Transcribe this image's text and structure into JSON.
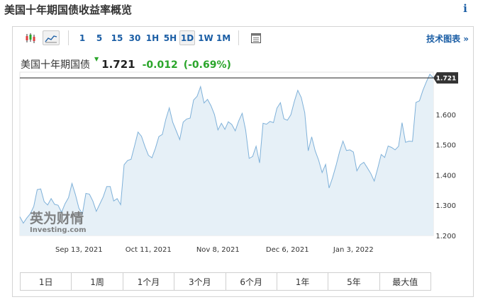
{
  "header": {
    "title": "美国十年期国债收益率概览",
    "info_icon": "i"
  },
  "toolbar": {
    "chart_type_icons": [
      "candlestick-icon",
      "area-chart-icon"
    ],
    "intervals": [
      {
        "label": "1",
        "active": false
      },
      {
        "label": "5",
        "active": false
      },
      {
        "label": "15",
        "active": false
      },
      {
        "label": "30",
        "active": false
      },
      {
        "label": "1H",
        "active": false
      },
      {
        "label": "5H",
        "active": false
      },
      {
        "label": "1D",
        "active": true
      },
      {
        "label": "1W",
        "active": false
      },
      {
        "label": "1M",
        "active": false
      }
    ],
    "table_icon": "table-icon",
    "tech_link": "技术图表 »"
  },
  "quote": {
    "name": "美国十年期国债",
    "arrow": "▼",
    "price": "1.721",
    "change": "-0.012",
    "change_pct": "(-0.69%)"
  },
  "watermark": {
    "cn": "英为财情",
    "en": "Investing.com"
  },
  "colors": {
    "accent": "#1b5ea5",
    "positive": "#2aa52a",
    "line": "#7fb1d9",
    "area": "#e6f0f7"
  },
  "chart_data": {
    "type": "area",
    "ylim": [
      1.2,
      1.74
    ],
    "y_ticks": [
      "1.200",
      "1.300",
      "1.400",
      "1.500",
      "1.600"
    ],
    "x_ticks": [
      "Sep 13, 2021",
      "Oct 11, 2021",
      "Nov 8, 2021",
      "Dec 6, 2021",
      "Jan 3, 2022"
    ],
    "x_tick_index": [
      17,
      37,
      57,
      77,
      96
    ],
    "last_value_label": "1.721",
    "last_value": 1.721,
    "values": [
      1.262,
      1.241,
      1.258,
      1.272,
      1.296,
      1.352,
      1.354,
      1.312,
      1.301,
      1.322,
      1.303,
      1.3,
      1.277,
      1.305,
      1.325,
      1.372,
      1.335,
      1.29,
      1.272,
      1.339,
      1.337,
      1.314,
      1.28,
      1.304,
      1.328,
      1.362,
      1.362,
      1.314,
      1.322,
      1.302,
      1.434,
      1.448,
      1.452,
      1.496,
      1.542,
      1.528,
      1.494,
      1.465,
      1.457,
      1.488,
      1.527,
      1.534,
      1.584,
      1.622,
      1.574,
      1.546,
      1.517,
      1.575,
      1.585,
      1.588,
      1.648,
      1.66,
      1.692,
      1.638,
      1.65,
      1.629,
      1.6,
      1.549,
      1.571,
      1.551,
      1.576,
      1.567,
      1.546,
      1.579,
      1.604,
      1.548,
      1.455,
      1.461,
      1.495,
      1.44,
      1.571,
      1.568,
      1.577,
      1.573,
      1.621,
      1.639,
      1.586,
      1.581,
      1.599,
      1.643,
      1.68,
      1.656,
      1.606,
      1.48,
      1.526,
      1.48,
      1.449,
      1.408,
      1.435,
      1.357,
      1.391,
      1.431,
      1.476,
      1.512,
      1.481,
      1.483,
      1.476,
      1.414,
      1.434,
      1.442,
      1.424,
      1.405,
      1.38,
      1.422,
      1.468,
      1.458,
      1.496,
      1.491,
      1.483,
      1.495,
      1.573,
      1.508,
      1.512,
      1.511,
      1.64,
      1.645,
      1.68,
      1.708,
      1.733,
      1.721
    ]
  },
  "periods": [
    "1日",
    "1周",
    "1个月",
    "3个月",
    "6个月",
    "1年",
    "5年",
    "最大值"
  ]
}
